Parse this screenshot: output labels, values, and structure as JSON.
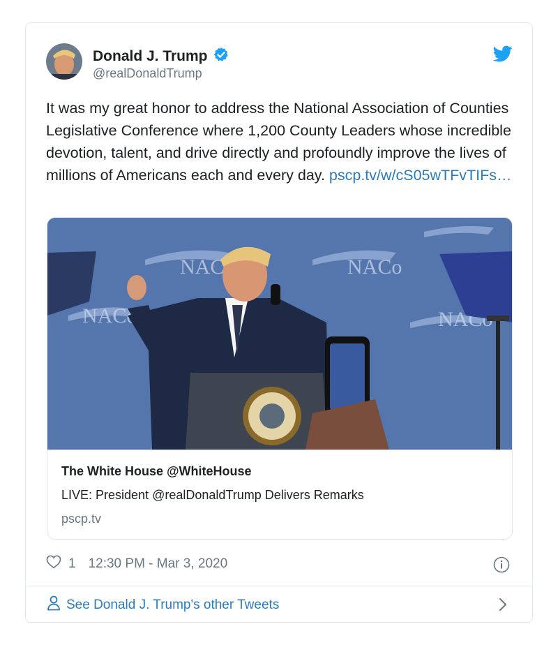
{
  "tweet": {
    "author_name": "Donald J. Trump",
    "author_handle": "@realDonaldTrump",
    "text": "It was my great honor to address the National Association of Counties Legislative Conference where 1,200 County Leaders whose incredible devotion, talent, and drive directly and profoundly improve the lives of millions of Americans each and every day.",
    "link": "pscp.tv/w/cS05wTFvTIFs…",
    "likes": "1",
    "timestamp": "12:30 PM - Mar 3, 2020"
  },
  "media": {
    "title": "The White House @WhiteHouse",
    "description": "LIVE: President @realDonaldTrump Delivers Remarks",
    "domain": "pscp.tv",
    "backdrop_text": "NACo"
  },
  "footer": {
    "label": "See Donald J. Trump's other Tweets"
  },
  "colors": {
    "link": "#2b7bb9",
    "verified": "#1da1f2",
    "muted": "#697882"
  },
  "icons": [
    "avatar",
    "verified-badge-icon",
    "twitter-bird-icon",
    "heart-icon",
    "info-icon",
    "person-icon",
    "chevron-right-icon"
  ]
}
